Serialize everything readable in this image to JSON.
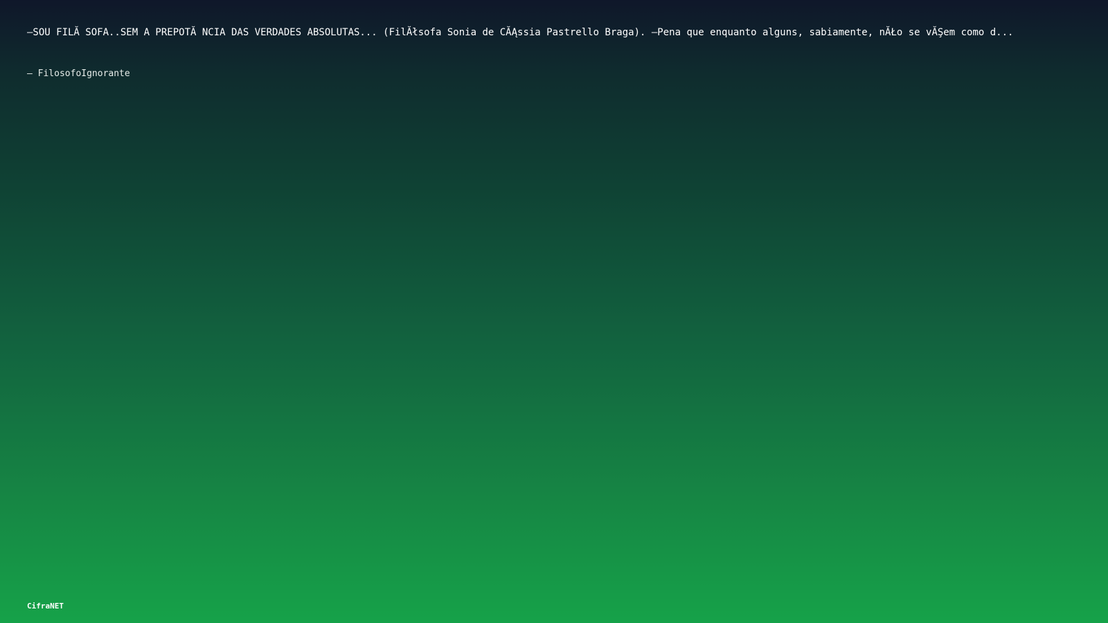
{
  "quote": {
    "text": "–SOU FILĂ SOFA..SEM A PREPOTĂ NCIA DAS VERDADES ABSOLUTAS... (FilĂłsofa Sonia de CĂĄssia Pastrello Braga). –Pena que enquanto alguns, sabiamente, nĂŁo se vĂŞem como d..."
  },
  "author": {
    "text": "– FilosofoIgnorante"
  },
  "brand": {
    "label": "CifraNET"
  }
}
